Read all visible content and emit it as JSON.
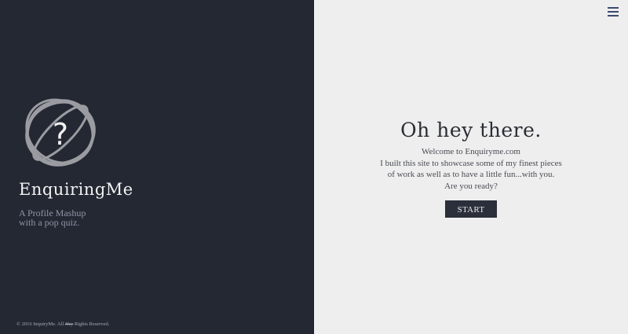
{
  "brand": {
    "name": "EnquiringMe",
    "tagline_line1": "A Profile Mashup",
    "tagline_line2": "with a pop quiz.",
    "logo_glyph": "?",
    "logo_icon": "question-orbit-icon"
  },
  "footer": {
    "prefix": "© 2016 InquiryMe. All ",
    "strike": "Hey",
    "suffix": " Rights Reserved."
  },
  "menu": {
    "icon": "hamburger-icon"
  },
  "hero": {
    "heading": "Oh hey there.",
    "lines": [
      "Welcome to Enquiryme.com",
      "I built this site to showcase some of my finest pieces",
      "of work as well as to have a little fun...with you.",
      "Are you ready?"
    ],
    "start_label": "START"
  },
  "colors": {
    "left_bg": "#242833",
    "right_bg": "#eeeeee",
    "button_bg": "#2b2f3b",
    "menu_icon": "#3a4a6e"
  }
}
